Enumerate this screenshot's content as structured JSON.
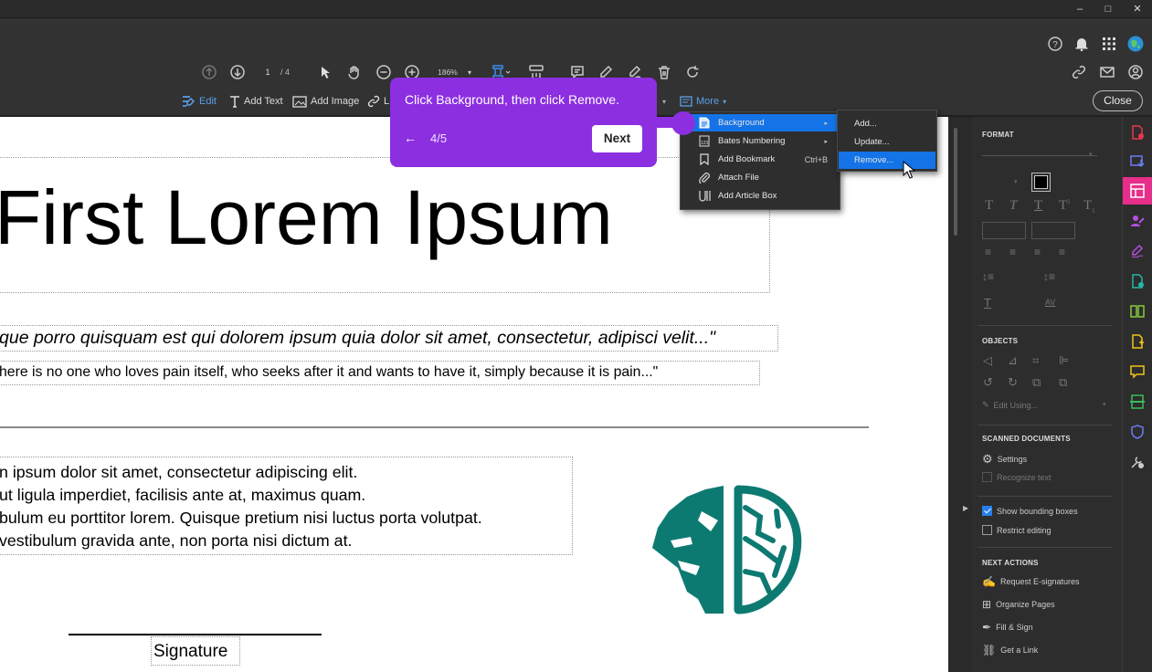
{
  "app": {
    "colors": {
      "accent": "#1473e6",
      "tooltip": "#8c2fe0",
      "panel": "#2d2d2d"
    }
  },
  "window": {
    "minimize": "–",
    "maximize": "□",
    "close": "✕"
  },
  "toolbar": {
    "page_current": "1",
    "page_total": "/ 4",
    "zoom": "186%",
    "zoom_arrow": "▾"
  },
  "edit_toolbar": {
    "edit": "Edit",
    "add_text": "Add Text",
    "add_image": "Add Image",
    "link": "L",
    "more": "More",
    "close": "Close"
  },
  "menu": {
    "items": [
      {
        "label": "Background",
        "icon": "background-icon",
        "shortcut": "",
        "submenu": true
      },
      {
        "label": "Bates Numbering",
        "icon": "bates-icon",
        "shortcut": "",
        "submenu": true
      },
      {
        "label": "Add Bookmark",
        "icon": "bookmark-icon",
        "shortcut": "Ctrl+B",
        "submenu": false
      },
      {
        "label": "Attach File",
        "icon": "paperclip-icon",
        "shortcut": "",
        "submenu": false
      },
      {
        "label": "Add Article Box",
        "icon": "article-icon",
        "shortcut": "",
        "submenu": false
      }
    ],
    "submenu": [
      "Add...",
      "Update...",
      "Remove..."
    ]
  },
  "tooltip": {
    "text": "Click Background, then click Remove.",
    "back": "←",
    "step": "4/5",
    "next": "Next"
  },
  "document": {
    "title": "First Lorem Ipsum",
    "quote1": "que porro quisquam est qui dolorem ipsum quia dolor sit amet, consectetur, adipisci velit...\"",
    "quote2": "here is no one who loves pain itself, who seeks after it and wants to have it, simply because it is pain...\"",
    "para": [
      "n ipsum dolor sit amet, consectetur adipiscing elit.",
      "ut ligula imperdiet, facilisis ante at, maximus quam.",
      "bulum eu porttitor lorem. Quisque pretium nisi luctus porta volutpat.",
      " vestibulum gravida ante, non porta nisi dictum at."
    ],
    "signature": "Signature"
  },
  "panel": {
    "format": "FORMAT",
    "objects": "OBJECTS",
    "edit_using": "Edit Using...",
    "scanned": "SCANNED DOCUMENTS",
    "settings": "Settings",
    "recognize": "Recognize text",
    "show_boxes": "Show bounding boxes",
    "show_boxes_checked": true,
    "restrict": "Restrict editing",
    "restrict_checked": false,
    "next_actions": "NEXT ACTIONS",
    "actions": [
      "Request E-signatures",
      "Organize Pages",
      "Fill & Sign",
      "Get a Link"
    ]
  }
}
